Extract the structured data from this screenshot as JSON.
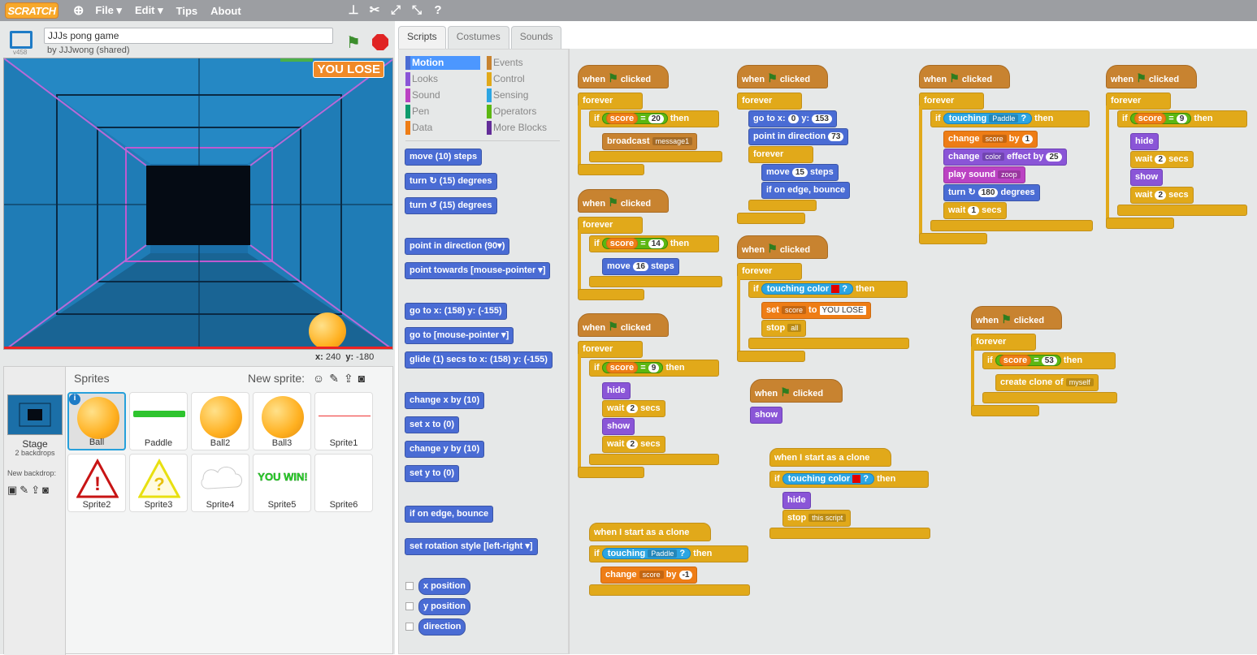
{
  "topbar": {
    "logo": "SCRATCH",
    "menus": [
      "File ▾",
      "Edit ▾",
      "Tips",
      "About"
    ]
  },
  "project": {
    "title": "JJJs pong game",
    "byline": "by JJJwong (shared)",
    "version": "v458"
  },
  "stage": {
    "overlay": "YOU LOSE",
    "mouse_x_label": "x:",
    "mouse_x": "240",
    "mouse_y_label": "y:",
    "mouse_y": "-180"
  },
  "sprites_panel": {
    "header": "Sprites",
    "new_sprite": "New sprite:",
    "stage_label": "Stage",
    "backdrops": "2 backdrops",
    "new_backdrop": "New backdrop:",
    "sprites": [
      "Ball",
      "Paddle",
      "Ball2",
      "Ball3",
      "Sprite1",
      "Sprite2",
      "Sprite3",
      "Sprite4",
      "Sprite5",
      "Sprite6"
    ],
    "sprite5_text": "YOU WIN!"
  },
  "tabs": [
    "Scripts",
    "Costumes",
    "Sounds"
  ],
  "categories": {
    "left": [
      "Motion",
      "Looks",
      "Sound",
      "Pen",
      "Data"
    ],
    "right": [
      "Events",
      "Control",
      "Sensing",
      "Operators",
      "More Blocks"
    ]
  },
  "palette": [
    "move (10) steps",
    "turn ↻ (15) degrees",
    "turn ↺ (15) degrees",
    "point in direction (90▾)",
    "point towards [mouse-pointer ▾]",
    "go to x: (158) y: (-155)",
    "go to [mouse-pointer ▾]",
    "glide (1) secs to x: (158) y: (-155)",
    "change x by (10)",
    "set x to (0)",
    "change y by (10)",
    "set y to (0)",
    "if on edge, bounce",
    "set rotation style [left-right ▾]",
    "x position",
    "y position",
    "direction"
  ],
  "scripts": {
    "when": "when",
    "clicked": "clicked",
    "forever": "forever",
    "if": "if",
    "then": "then",
    "score": "score",
    "message1": "message1",
    "broadcast": "broadcast",
    "move": "move",
    "steps": "steps",
    "hide": "hide",
    "show": "show",
    "wait": "wait",
    "secs": "secs",
    "goto": "go to x:",
    "y": "y:",
    "point_dir": "point in direction",
    "bounce": "if on edge, bounce",
    "touching": "touching",
    "touching_color": "touching color",
    "set": "set",
    "to": "to",
    "you_lose": "YOU LOSE",
    "stop": "stop",
    "all": "all",
    "this_script": "this script",
    "clone_start": "when I start as a clone",
    "paddle": "Paddle",
    "change": "change",
    "by": "by",
    "color": "color",
    "effect_by": "effect by",
    "play_sound": "play sound",
    "zoop": "zoop",
    "turn": "turn",
    "degrees": "degrees",
    "create_clone": "create clone of",
    "myself": "myself",
    "v20": "20",
    "v14": "14",
    "v9": "9",
    "v16": "16",
    "v0": "0",
    "v153": "153",
    "v73": "73",
    "v15": "15",
    "v1": "1",
    "v25": "25",
    "v180": "180",
    "v2": "2",
    "v53": "53",
    "vm1": "-1"
  },
  "colors": {
    "motion": "#4a6cd4",
    "control": "#e1a91a",
    "events": "#c88330",
    "looks": "#8a55d7",
    "sensing": "#2ca5e2",
    "sound": "#bb42c3",
    "data": "#ee7d16",
    "operators": "#5cb712"
  }
}
